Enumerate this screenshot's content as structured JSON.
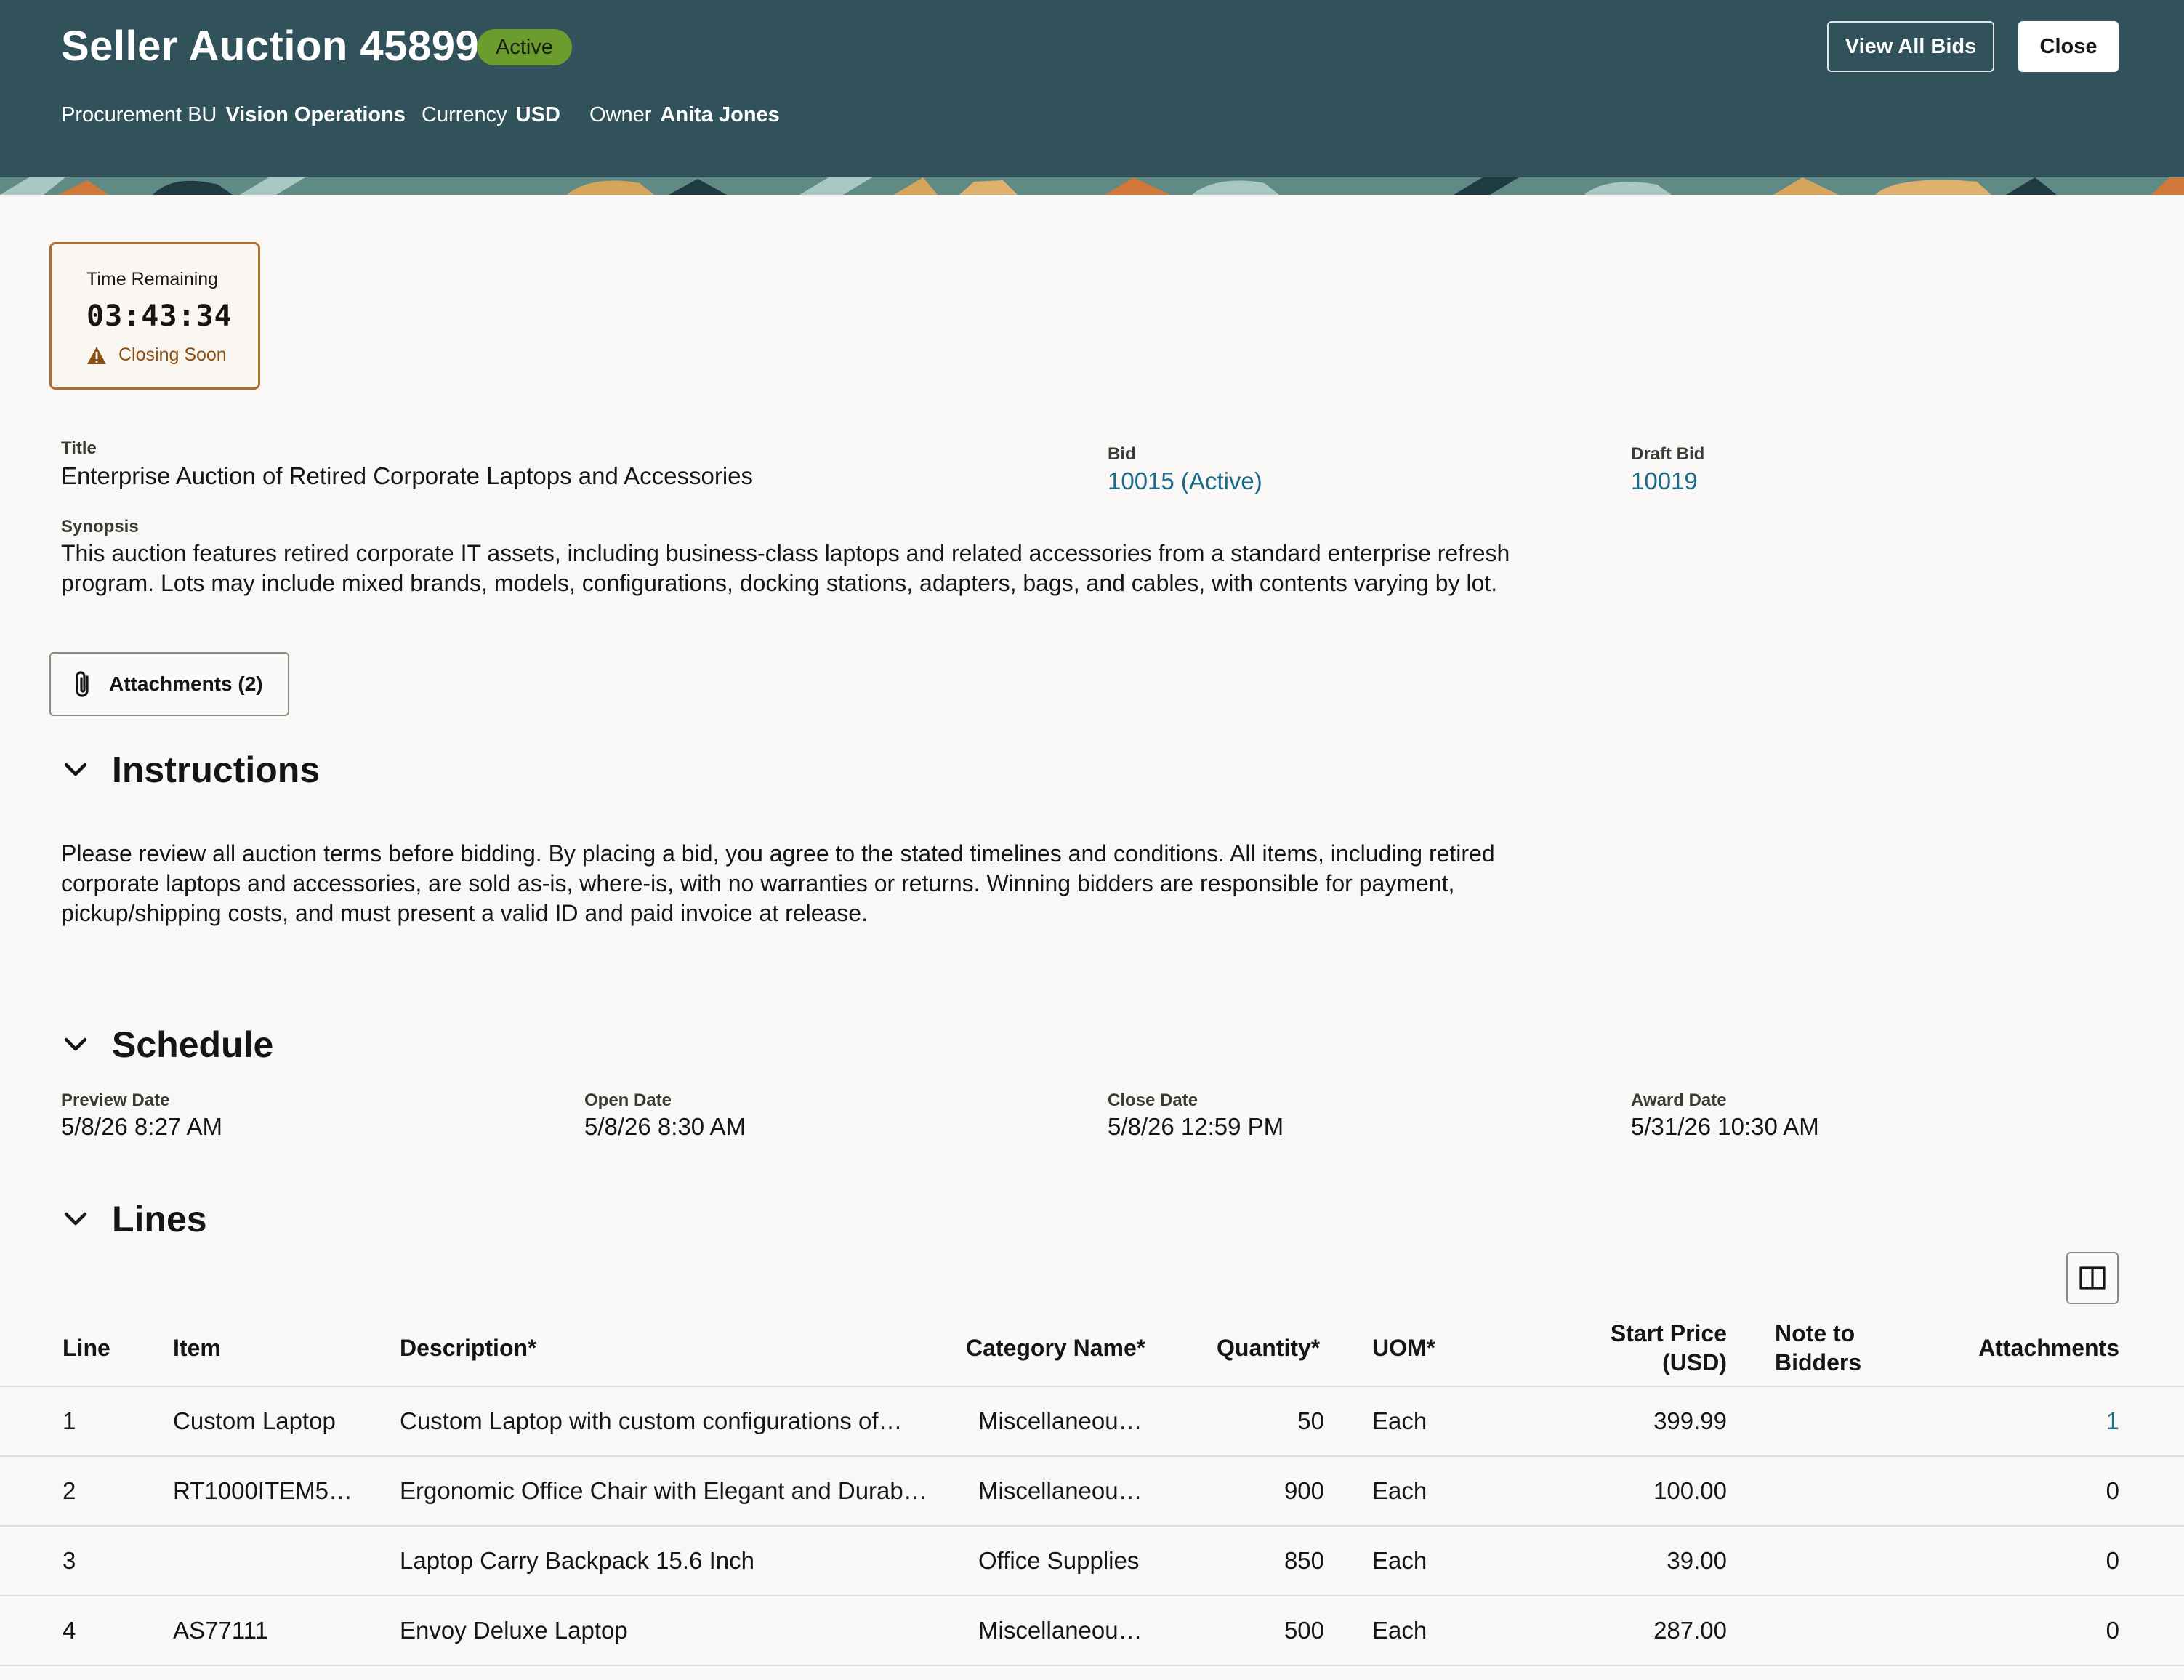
{
  "header": {
    "title": "Seller Auction 45899",
    "status": "Active",
    "procurement_bu_label": "Procurement BU",
    "procurement_bu": "Vision Operations",
    "currency_label": "Currency",
    "currency": "USD",
    "owner_label": "Owner",
    "owner": "Anita Jones",
    "view_all_bids": "View All Bids",
    "close": "Close",
    "colors": {
      "background": "#31525a",
      "badge": "#6c9b2e"
    }
  },
  "timer": {
    "label": "Time Remaining",
    "value": "03:43:34",
    "warning": "Closing Soon"
  },
  "details": {
    "title_label": "Title",
    "title": "Enterprise Auction of Retired Corporate Laptops and Accessories",
    "bid_label": "Bid",
    "bid": "10015 (Active)",
    "draft_bid_label": "Draft Bid",
    "draft_bid": "10019",
    "synopsis_label": "Synopsis",
    "synopsis": "This auction features retired corporate IT assets, including business-class laptops and related accessories from a standard enterprise refresh program. Lots may include mixed brands, models, configurations, docking stations, adapters, bags, and cables, with contents varying by lot."
  },
  "attachments_button": "Attachments (2)",
  "instructions": {
    "heading": "Instructions",
    "text": "Please review all auction terms before bidding. By placing a bid, you agree to the stated timelines and conditions. All items, including retired corporate laptops and accessories, are sold as-is, where-is, with no warranties or returns. Winning bidders are responsible for payment, pickup/shipping costs, and must present a valid ID and paid invoice at release."
  },
  "schedule": {
    "heading": "Schedule",
    "preview_label": "Preview Date",
    "preview": "5/8/26 8:27 AM",
    "open_label": "Open Date",
    "open": "5/8/26 8:30 AM",
    "close_label": "Close Date",
    "close": "5/8/26 12:59 PM",
    "award_label": "Award Date",
    "award": "5/31/26 10:30 AM"
  },
  "lines": {
    "heading": "Lines",
    "columns": {
      "line": "Line",
      "item": "Item",
      "description": "Description*",
      "category": "Category Name*",
      "quantity": "Quantity*",
      "uom": "UOM*",
      "start_price_1": "Start Price",
      "start_price_2": "(USD)",
      "note_1": "Note to",
      "note_2": "Bidders",
      "attachments": "Attachments"
    },
    "rows": [
      {
        "line": "1",
        "item": "Custom Laptop",
        "description": "Custom Laptop with custom configurations of…",
        "category": "Miscellaneou…",
        "quantity": "50",
        "uom": "Each",
        "start_price": "399.99",
        "note": "",
        "attachments": "1"
      },
      {
        "line": "2",
        "item": "RT1000ITEM5…",
        "description": "Ergonomic Office Chair with Elegant and Durab…",
        "category": "Miscellaneou…",
        "quantity": "900",
        "uom": "Each",
        "start_price": "100.00",
        "note": "",
        "attachments": "0"
      },
      {
        "line": "3",
        "item": "",
        "description": "Laptop Carry Backpack 15.6 Inch",
        "category": "Office Supplies",
        "quantity": "850",
        "uom": "Each",
        "start_price": "39.00",
        "note": "",
        "attachments": "0"
      },
      {
        "line": "4",
        "item": "AS77111",
        "description": "Envoy Deluxe Laptop",
        "category": "Miscellaneou…",
        "quantity": "500",
        "uom": "Each",
        "start_price": "287.00",
        "note": "",
        "attachments": "0"
      }
    ]
  }
}
